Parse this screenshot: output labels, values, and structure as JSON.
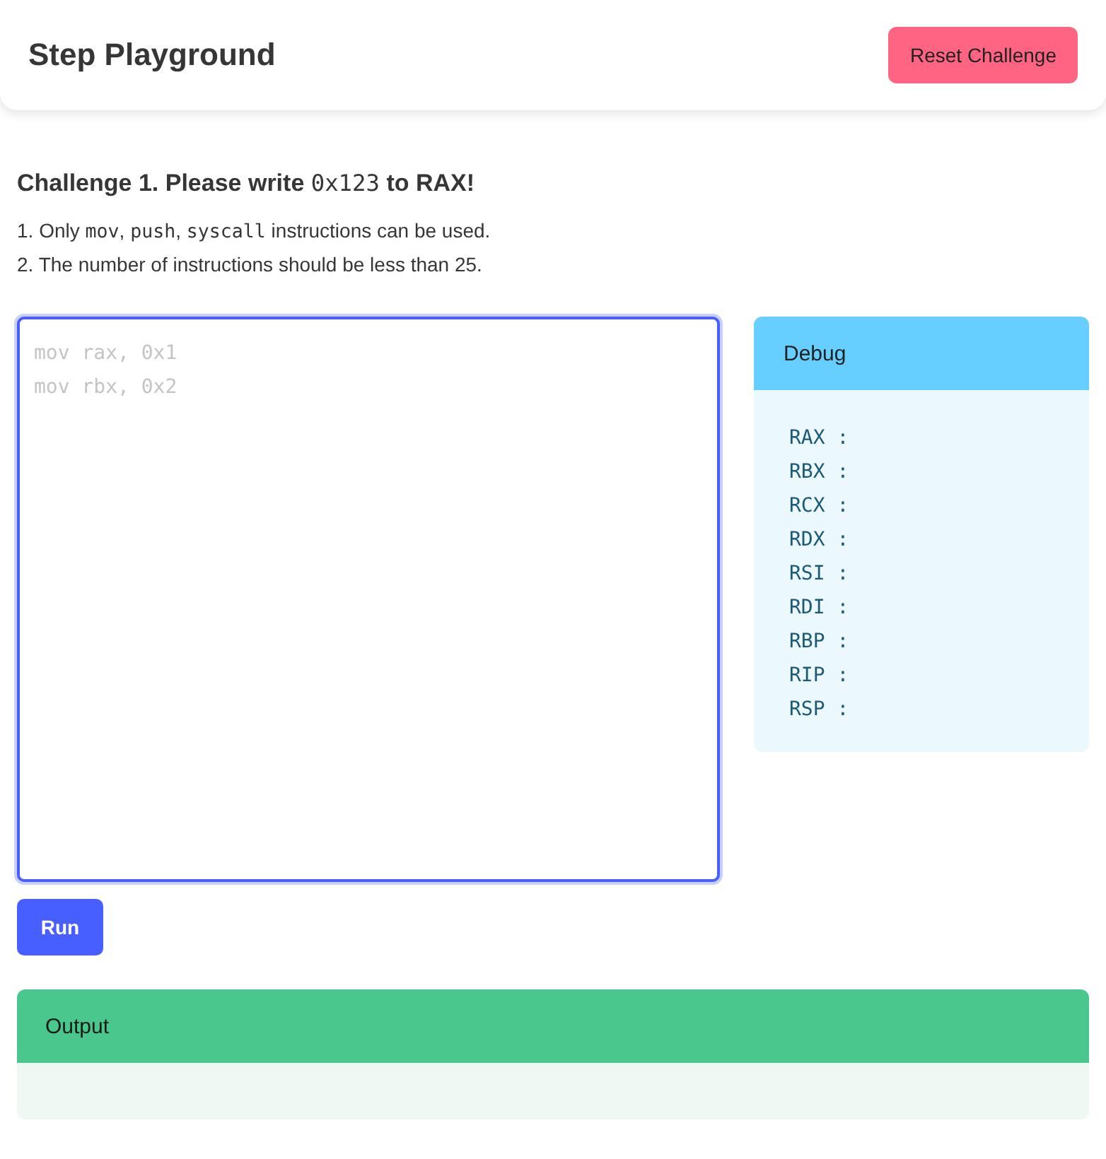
{
  "header": {
    "title": "Step Playground",
    "reset_button": "Reset Challenge"
  },
  "challenge": {
    "title": [
      {
        "text": "Challenge 1. Please write ",
        "code": false
      },
      {
        "text": "0x123",
        "code": true
      },
      {
        "text": " to RAX!",
        "code": false
      }
    ],
    "rules": [
      [
        {
          "text": "1. Only ",
          "code": false
        },
        {
          "text": "mov",
          "code": true
        },
        {
          "text": ", ",
          "code": false
        },
        {
          "text": "push",
          "code": true
        },
        {
          "text": ", ",
          "code": false
        },
        {
          "text": "syscall",
          "code": true
        },
        {
          "text": " instructions can be used.",
          "code": false
        }
      ],
      [
        {
          "text": "2. The number of instructions should be less than 25.",
          "code": false
        }
      ]
    ]
  },
  "editor": {
    "placeholder": "mov rax, 0x1\nmov rbx, 0x2"
  },
  "run_button": "Run",
  "debug": {
    "title": "Debug",
    "registers": [
      "RAX :",
      "RBX :",
      "RCX :",
      "RDX :",
      "RSI :",
      "RDI :",
      "RBP :",
      "RIP :",
      "RSP :"
    ]
  },
  "output": {
    "title": "Output"
  }
}
